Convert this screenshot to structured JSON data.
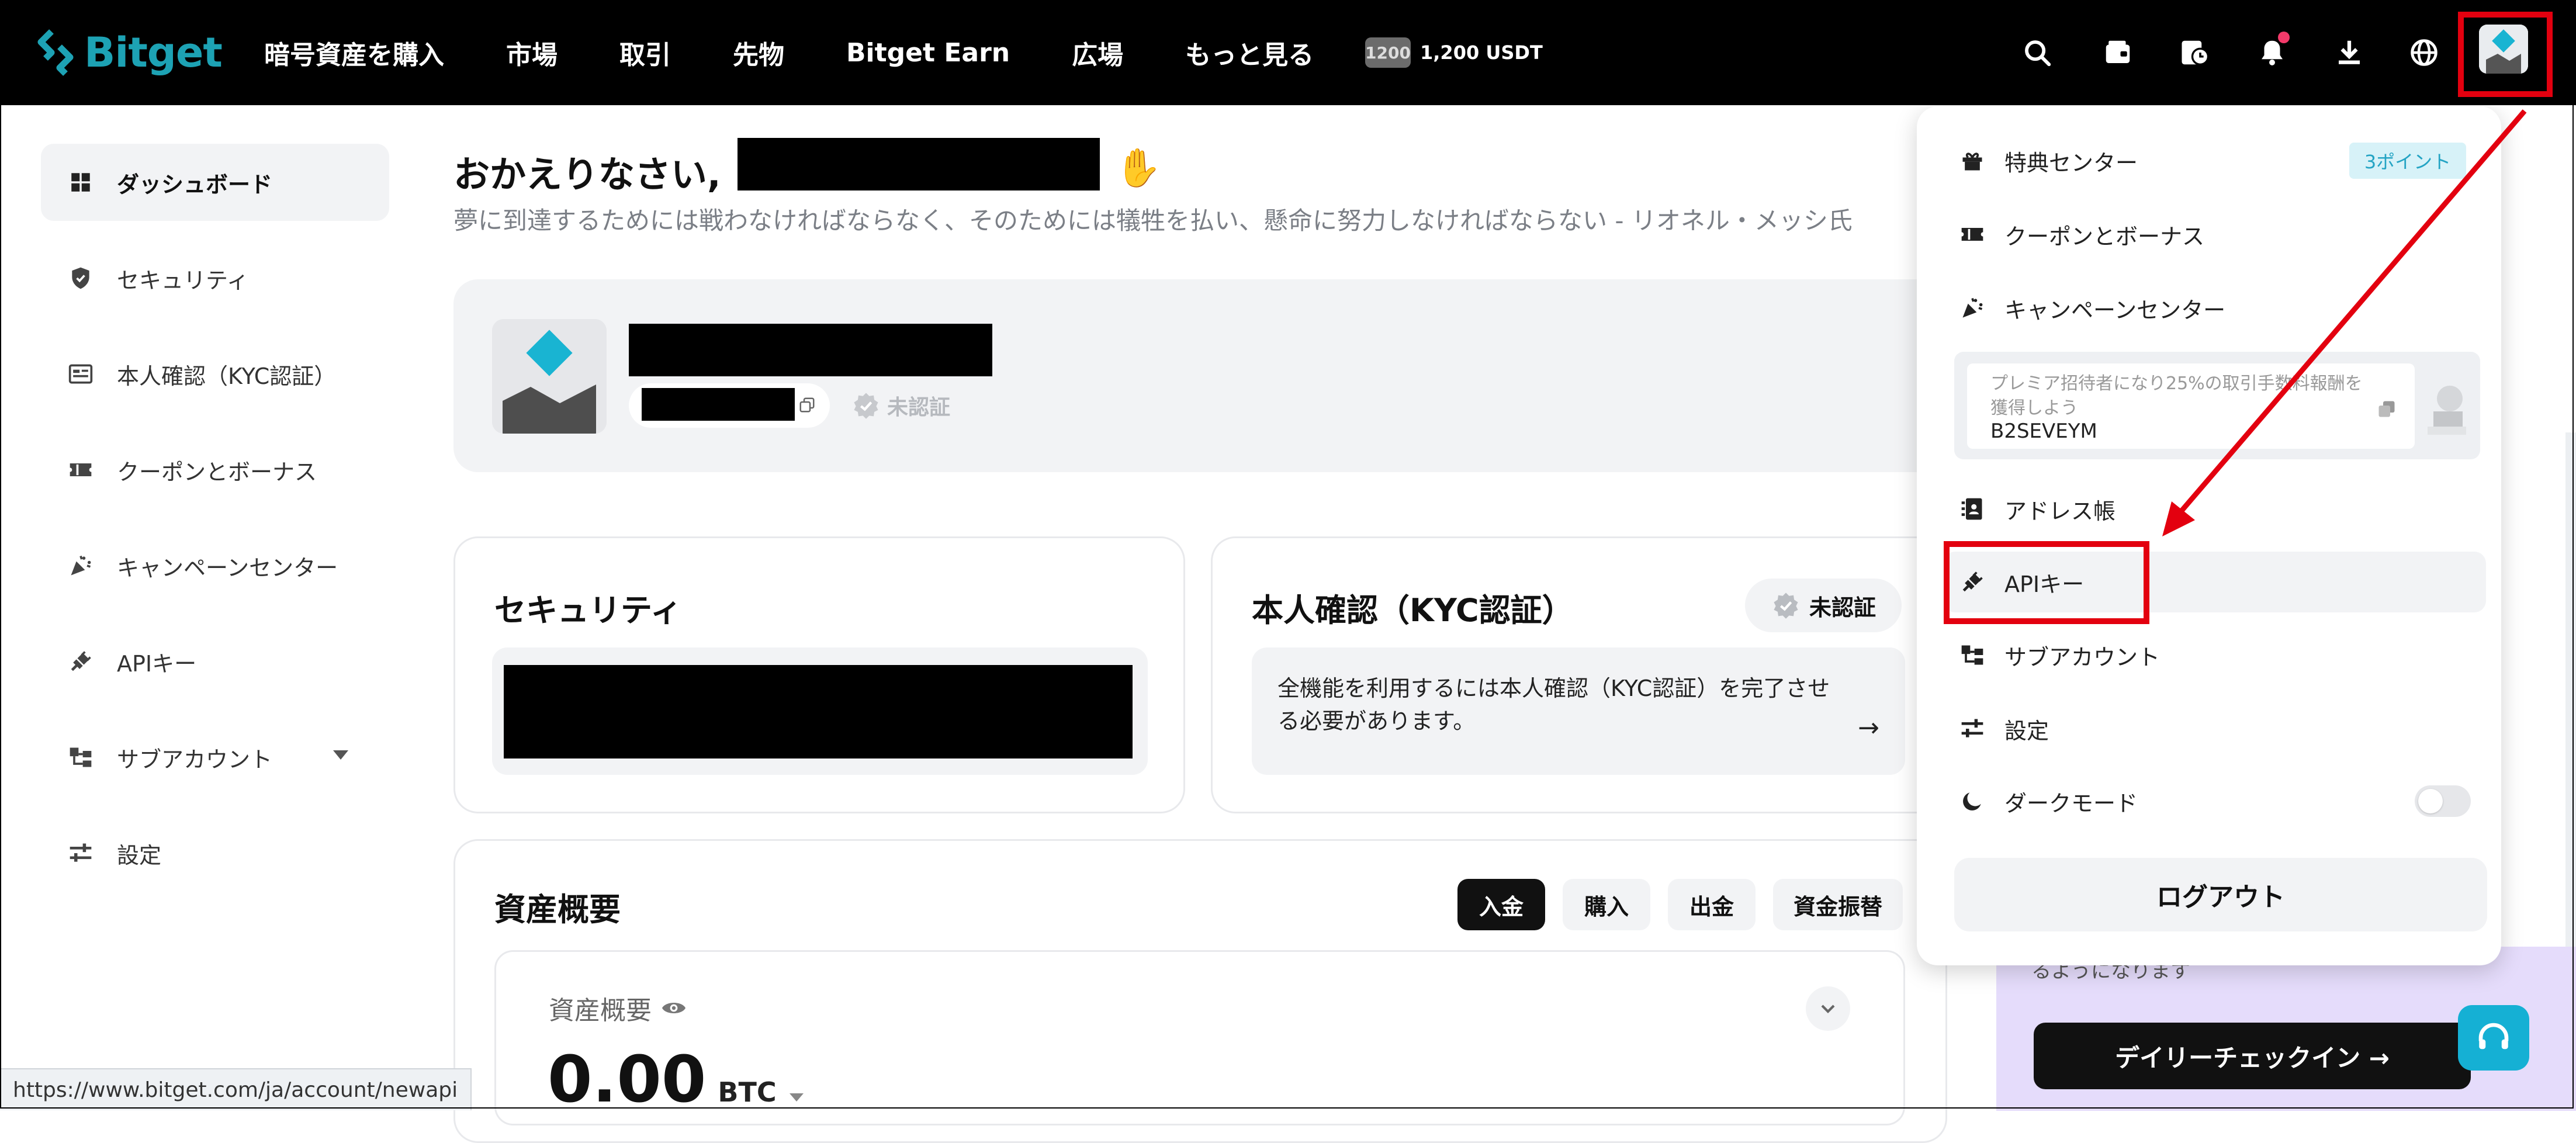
{
  "brand": {
    "name": "Bitget",
    "accent": "#1da2b4"
  },
  "nav": {
    "items": [
      "暗号資産を購入",
      "市場",
      "取引",
      "先物",
      "Bitget Earn",
      "広場",
      "もっと見る"
    ],
    "promo_badge": "1200",
    "promo_text": "1,200 USDT",
    "icons": [
      "search-icon",
      "wallet-icon",
      "history-icon",
      "bell-icon",
      "download-icon",
      "globe-icon"
    ]
  },
  "sidebar": {
    "items": [
      {
        "label": "ダッシュボード",
        "icon": "dashboard-icon",
        "active": true
      },
      {
        "label": "セキュリティ",
        "icon": "shield-icon"
      },
      {
        "label": "本人確認（KYC認証）",
        "icon": "id-card-icon"
      },
      {
        "label": "クーポンとボーナス",
        "icon": "ticket-icon"
      },
      {
        "label": "キャンペーンセンター",
        "icon": "party-popper-icon"
      },
      {
        "label": "APIキー",
        "icon": "plug-icon"
      },
      {
        "label": "サブアカウント",
        "icon": "sub-account-icon",
        "expandable": true
      },
      {
        "label": "設定",
        "icon": "sliders-icon"
      }
    ]
  },
  "main": {
    "greeting": "おかえりなさい,",
    "quote": "夢に到達するためには戦わなければならなく、そのためには犠牲を払い、懸命に努力しなければならない - リオネル・メッシ氏",
    "profile": {
      "status": "未認証"
    },
    "security": {
      "title": "セキュリティ"
    },
    "kyc": {
      "title": "本人確認（KYC認証）",
      "badge": "未認証",
      "message": "全機能を利用するには本人確認（KYC認証）を完了させる必要があります。",
      "arrow": "→"
    },
    "assets": {
      "title": "資産概要",
      "buttons": [
        "入金",
        "購入",
        "出金",
        "資金振替"
      ],
      "label": "資産概要",
      "value": "0.00",
      "unit": "BTC"
    },
    "daily_checkin": "デイリーチェックイン →",
    "promo_fragment": "るようになります"
  },
  "dropdown": {
    "items": [
      {
        "label": "特典センター",
        "icon": "gift-icon",
        "badge": "3ポイント"
      },
      {
        "label": "クーポンとボーナス",
        "icon": "ticket-icon"
      },
      {
        "label": "キャンペーンセンター",
        "icon": "party-popper-icon"
      },
      {
        "label": "アドレス帳",
        "icon": "address-book-icon"
      },
      {
        "label": "APIキー",
        "icon": "plug-icon",
        "highlighted": true
      },
      {
        "label": "サブアカウント",
        "icon": "sub-account-icon"
      },
      {
        "label": "設定",
        "icon": "sliders-icon"
      },
      {
        "label": "ダークモード",
        "icon": "moon-icon",
        "toggle": false
      }
    ],
    "referral": {
      "description": "プレミア招待者になり25%の取引手数料報酬を獲得しよう",
      "code": "B2SEVEYM"
    },
    "logout": "ログアウト"
  },
  "annotation": {
    "color": "#e3000f"
  },
  "status_bar": {
    "url": "https://www.bitget.com/ja/account/newapi"
  }
}
